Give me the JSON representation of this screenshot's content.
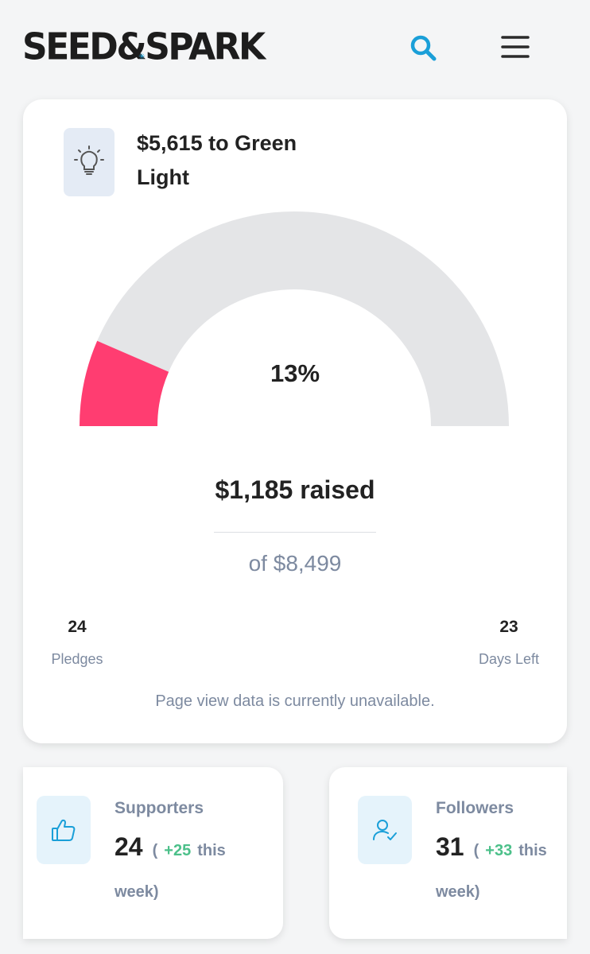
{
  "header": {
    "logo_left": "SEED",
    "logo_amp": "&",
    "logo_right": "SPARK",
    "search_icon": "search-icon",
    "menu_icon": "hamburger-menu-icon"
  },
  "campaign": {
    "goal_title": "$5,615 to Green Light",
    "percent_label": "13%",
    "percent_value": 13,
    "raised_label": "$1,185 raised",
    "of_goal_label": "of $8,499",
    "pledges_count": "24",
    "pledges_label": "Pledges",
    "days_left_count": "23",
    "days_left_label": "Days Left",
    "page_view_note": "Page view data is currently unavailable."
  },
  "supporters": {
    "label": "Supporters",
    "count": "24",
    "open_paren": "(",
    "delta": "+25",
    "this_word": "this",
    "week_word": "week)"
  },
  "followers": {
    "label": "Followers",
    "count": "31",
    "open_paren": "(",
    "delta": "+33",
    "this_word": "this",
    "week_word": "week)"
  },
  "colors": {
    "accent_blue": "#1a9fd8",
    "gauge_fill": "#ff3d71",
    "gauge_track": "#e4e5e7",
    "delta_green": "#4cc08a"
  }
}
